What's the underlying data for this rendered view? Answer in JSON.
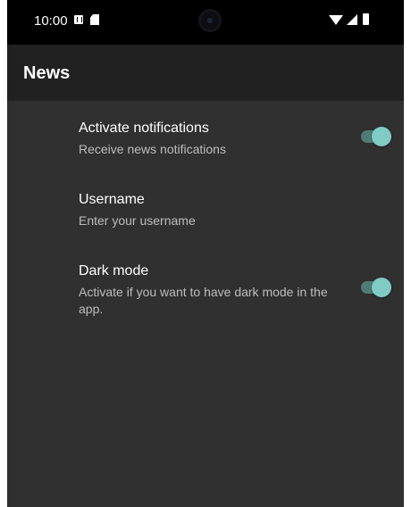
{
  "status_bar": {
    "time": "10:00",
    "icons": [
      "a-notification-icon",
      "sd-card-icon",
      "wifi-icon",
      "cell-signal-icon",
      "battery-icon"
    ]
  },
  "app_bar": {
    "title": "News"
  },
  "preferences": [
    {
      "title": "Activate notifications",
      "summary": "Receive news notifications",
      "type": "switch",
      "checked": true
    },
    {
      "title": "Username",
      "summary": "Enter your username",
      "type": "text"
    },
    {
      "title": "Dark mode",
      "summary": "Activate if you want to have dark mode in the app.",
      "type": "switch",
      "checked": true
    }
  ],
  "colors": {
    "background": "#303030",
    "app_bar": "#212121",
    "accent": "#80cbc4",
    "track": "#4f7c76"
  }
}
